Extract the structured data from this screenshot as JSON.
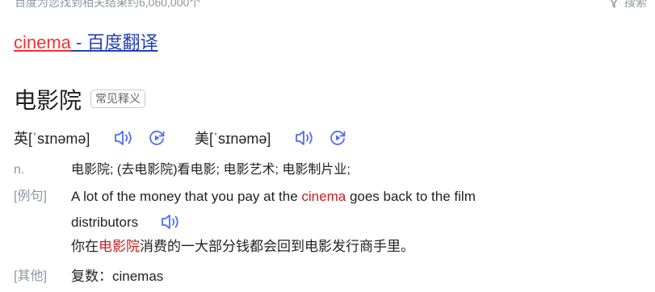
{
  "header": {
    "result_count": "百度为您找到相关结果约6,060,000个",
    "filter_label": "搜索"
  },
  "result": {
    "title_keyword": "cinema",
    "title_sep": " - ",
    "title_source": "百度翻译"
  },
  "entry": {
    "headword": "电影院",
    "tag": "常见释义",
    "uk_label": "英",
    "uk_phonetic": "[ˈsɪnəmə]",
    "us_label": "美",
    "us_phonetic": "[ˈsɪnəmə]",
    "pos": "n.",
    "definition": "电影院; (去电影院)看电影; 电影艺术; 电影制片业;",
    "example_label": "[例句]",
    "example_en_before": "A lot of the money that you pay at the ",
    "example_en_keyword": "cinema",
    "example_en_after": " goes back to the film",
    "example_en_line2": "distributors",
    "example_zh_before": "你在",
    "example_zh_keyword": "电影院",
    "example_zh_after": "消费的一大部分钱都会回到电影发行商手里。",
    "other_label": "[其他]",
    "other_text": "复数：cinemas"
  },
  "colors": {
    "link": "#2440b3",
    "highlight": "#f73131",
    "icon": "#4e6ef2",
    "muted": "#9195a3"
  }
}
